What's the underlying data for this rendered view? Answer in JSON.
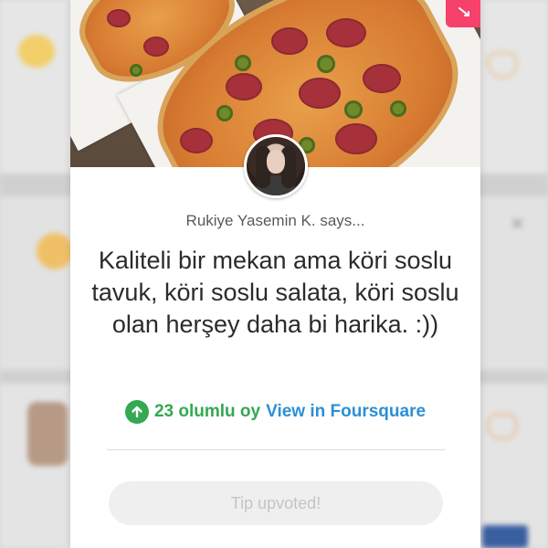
{
  "tip": {
    "author_line": "Rukiye Yasemin K. says...",
    "text": "Kaliteli bir mekan ama köri soslu tavuk, köri soslu salata, köri soslu olan herşey daha bi harika. :))",
    "upvote_count_label": "23 olumlu oy",
    "view_link_label": "View in Foursquare",
    "upvoted_button_label": "Tip upvoted!"
  },
  "icons": {
    "upvote": "arrow-up-icon",
    "bookmark": "bookmark-ribbon-icon",
    "avatar": "user-avatar"
  },
  "colors": {
    "accent_green": "#34a853",
    "link_blue": "#2d8fd5",
    "ribbon_pink": "#f5416c"
  }
}
